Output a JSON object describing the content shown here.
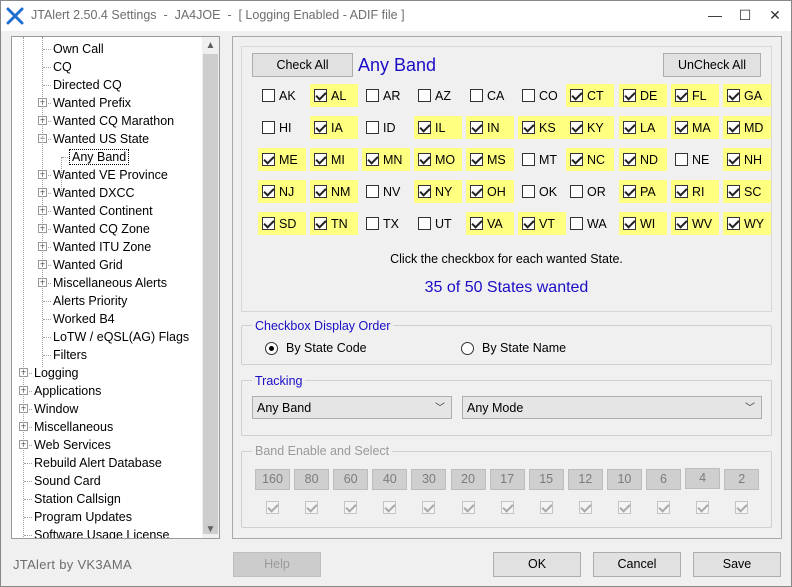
{
  "window": {
    "title": "JTAlert 2.50.4 Settings  -  JA4JOE  -  [ Logging Enabled - ADIF file ]",
    "controls": {
      "minimize": "—",
      "maximize": "☐",
      "close": "✕"
    }
  },
  "tree": {
    "items": [
      {
        "label": "Own Call",
        "level": 2,
        "expander": false
      },
      {
        "label": "CQ",
        "level": 2,
        "expander": false
      },
      {
        "label": "Directed CQ",
        "level": 2,
        "expander": false
      },
      {
        "label": "Wanted Prefix",
        "level": 2,
        "expander": "+"
      },
      {
        "label": "Wanted CQ Marathon",
        "level": 2,
        "expander": "+"
      },
      {
        "label": "Wanted US State",
        "level": 2,
        "expander": "−"
      },
      {
        "label": "Any Band",
        "level": 3,
        "expander": false,
        "selected": true
      },
      {
        "label": "Wanted VE Province",
        "level": 2,
        "expander": "+"
      },
      {
        "label": "Wanted DXCC",
        "level": 2,
        "expander": "+"
      },
      {
        "label": "Wanted Continent",
        "level": 2,
        "expander": "+"
      },
      {
        "label": "Wanted CQ Zone",
        "level": 2,
        "expander": "+"
      },
      {
        "label": "Wanted ITU Zone",
        "level": 2,
        "expander": "+"
      },
      {
        "label": "Wanted Grid",
        "level": 2,
        "expander": "+"
      },
      {
        "label": "Miscellaneous Alerts",
        "level": 2,
        "expander": "+"
      },
      {
        "label": "Alerts Priority",
        "level": 2,
        "expander": false
      },
      {
        "label": "Worked B4",
        "level": 2,
        "expander": false
      },
      {
        "label": "LoTW / eQSL(AG) Flags",
        "level": 2,
        "expander": false
      },
      {
        "label": "Filters",
        "level": 2,
        "expander": false
      },
      {
        "label": "Logging",
        "level": 1,
        "expander": "+"
      },
      {
        "label": "Applications",
        "level": 1,
        "expander": "+"
      },
      {
        "label": "Window",
        "level": 1,
        "expander": "+"
      },
      {
        "label": "Miscellaneous",
        "level": 1,
        "expander": "+"
      },
      {
        "label": "Web Services",
        "level": 1,
        "expander": "+"
      },
      {
        "label": "Rebuild Alert Database",
        "level": 1,
        "expander": false
      },
      {
        "label": "Sound Card",
        "level": 1,
        "expander": false
      },
      {
        "label": "Station Callsign",
        "level": 1,
        "expander": false
      },
      {
        "label": "Program Updates",
        "level": 1,
        "expander": false
      },
      {
        "label": "Software Usage License",
        "level": 1,
        "expander": false
      }
    ],
    "scroll_up": "▲",
    "scroll_down": "▼"
  },
  "band_panel": {
    "check_all": "Check All",
    "uncheck_all": "UnCheck All",
    "title": "Any Band",
    "states": [
      [
        {
          "code": "AK",
          "on": false
        },
        {
          "code": "AL",
          "on": true
        },
        {
          "code": "AR",
          "on": false
        },
        {
          "code": "AZ",
          "on": false
        },
        {
          "code": "CA",
          "on": false
        },
        {
          "code": "CO",
          "on": false
        },
        {
          "code": "CT",
          "on": true
        },
        {
          "code": "DE",
          "on": true
        },
        {
          "code": "FL",
          "on": true
        },
        {
          "code": "GA",
          "on": true
        }
      ],
      [
        {
          "code": "HI",
          "on": false
        },
        {
          "code": "IA",
          "on": true
        },
        {
          "code": "ID",
          "on": false
        },
        {
          "code": "IL",
          "on": true
        },
        {
          "code": "IN",
          "on": true
        },
        {
          "code": "KS",
          "on": true
        },
        {
          "code": "KY",
          "on": true
        },
        {
          "code": "LA",
          "on": true
        },
        {
          "code": "MA",
          "on": true
        },
        {
          "code": "MD",
          "on": true
        }
      ],
      [
        {
          "code": "ME",
          "on": true
        },
        {
          "code": "MI",
          "on": true
        },
        {
          "code": "MN",
          "on": true
        },
        {
          "code": "MO",
          "on": true
        },
        {
          "code": "MS",
          "on": true
        },
        {
          "code": "MT",
          "on": false
        },
        {
          "code": "NC",
          "on": true
        },
        {
          "code": "ND",
          "on": true
        },
        {
          "code": "NE",
          "on": false
        },
        {
          "code": "NH",
          "on": true
        }
      ],
      [
        {
          "code": "NJ",
          "on": true
        },
        {
          "code": "NM",
          "on": true
        },
        {
          "code": "NV",
          "on": false
        },
        {
          "code": "NY",
          "on": true
        },
        {
          "code": "OH",
          "on": true
        },
        {
          "code": "OK",
          "on": false
        },
        {
          "code": "OR",
          "on": false
        },
        {
          "code": "PA",
          "on": true
        },
        {
          "code": "RI",
          "on": true
        },
        {
          "code": "SC",
          "on": true
        }
      ],
      [
        {
          "code": "SD",
          "on": true
        },
        {
          "code": "TN",
          "on": true
        },
        {
          "code": "TX",
          "on": false
        },
        {
          "code": "UT",
          "on": false
        },
        {
          "code": "VA",
          "on": true
        },
        {
          "code": "VT",
          "on": true
        },
        {
          "code": "WA",
          "on": false
        },
        {
          "code": "WI",
          "on": true
        },
        {
          "code": "WV",
          "on": true
        },
        {
          "code": "WY",
          "on": true
        }
      ]
    ],
    "hint": "Click the checkbox for each wanted State.",
    "count": "35 of 50 States wanted",
    "highlight_color": "#ffff80"
  },
  "display_order": {
    "label": "Checkbox Display Order",
    "by_code": "By State Code",
    "by_name": "By State Name",
    "selected": "by_code"
  },
  "tracking": {
    "label": "Tracking",
    "band_value": "Any Band",
    "mode_value": "Any Mode"
  },
  "band_enable": {
    "label": "Band Enable and Select",
    "bands": [
      "160",
      "80",
      "60",
      "40",
      "30",
      "20",
      "17",
      "15",
      "12",
      "10",
      "6",
      "4",
      "2"
    ]
  },
  "footer": {
    "brand": "JTAlert by VK3AMA",
    "help": "Help",
    "ok": "OK",
    "cancel": "Cancel",
    "save": "Save"
  },
  "colors": {
    "accent": "#1a0dc6",
    "logo": "#1f6fd1"
  }
}
